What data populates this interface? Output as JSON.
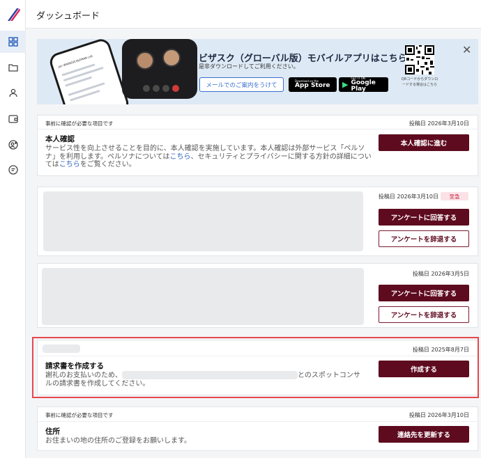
{
  "header": {
    "title": "ダッシュボード"
  },
  "sidebar": {
    "items": [
      {
        "icon": "dashboard-icon",
        "active": true
      },
      {
        "icon": "folder-icon",
        "active": false
      },
      {
        "icon": "person-icon",
        "active": false
      },
      {
        "icon": "wallet-icon",
        "active": false
      },
      {
        "icon": "add-user-icon",
        "active": false
      },
      {
        "icon": "chat-icon",
        "active": false
      }
    ]
  },
  "banner": {
    "title": "ビザスク（グローバル版）モバイルアプリはこちら",
    "subtitle": "是非ダウンロードしてご利用ください。",
    "mail_button": "メールでのご案内をうけて",
    "app_store_small": "Download on the",
    "app_store": "App Store",
    "google_play_small": "GET IT ON",
    "google_play": "Google Play",
    "qr_text": "QRコードからダウンロードする場合はこちら",
    "phone_user": "Jon WASKO/COLEMAN call"
  },
  "cards": {
    "identity": {
      "label": "事前に確認が必要な項目です",
      "date": "投稿日 2026年3月10日",
      "title": "本人確認",
      "body_1": "サービス性を向上させることを目的に、本人確認を実施しています。本人確認は外部サービス「ペルソナ」を利用します。ペルソナについては",
      "link_1": "こちら",
      "body_2": "、セキュリティとプライバシーに関する方針の詳細については",
      "link_2": "こちら",
      "body_3": "をご覧ください。",
      "button": "本人確認に進む"
    },
    "survey1": {
      "date": "投稿日 2026年3月10日",
      "badge": "至急",
      "answer_button": "アンケートに回答する",
      "decline_button": "アンケートを辞退する"
    },
    "survey2": {
      "date": "投稿日 2026年3月5日",
      "answer_button": "アンケートに回答する",
      "decline_button": "アンケートを辞退する"
    },
    "invoice": {
      "date": "投稿日 2025年8月7日",
      "title": "請求書を作成する",
      "body_pre": "謝礼のお支払いのため、",
      "body_post": "とのスポットコンサ",
      "body_line2": "ルの請求書を作成してください。",
      "button": "作成する"
    },
    "address": {
      "label": "事前に確認が必要な項目です",
      "date": "投稿日 2026年3月10日",
      "title": "住所",
      "body": "お住まいの地の住所のご登録をお願いします。",
      "button": "連絡先を更新する"
    }
  },
  "colors": {
    "primary": "#5e0a1f",
    "highlight": "#e5474e",
    "link": "#2a5fb8",
    "banner_bg": "#dde9f4"
  }
}
